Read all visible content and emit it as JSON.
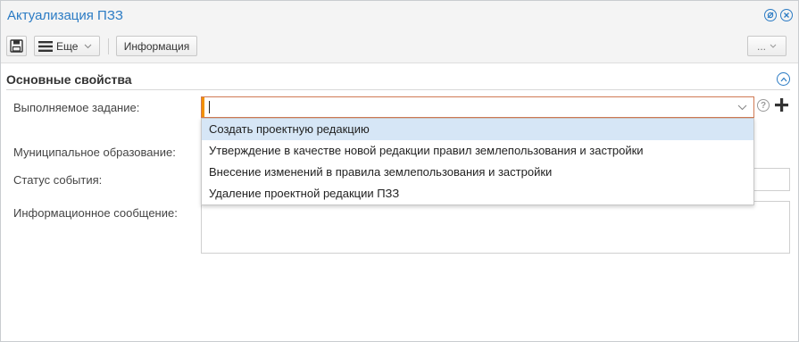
{
  "window": {
    "title": "Актуализация ПЗЗ"
  },
  "toolbar": {
    "more_label": "Еще",
    "info_label": "Информация",
    "ellipsis_label": "..."
  },
  "section": {
    "title": "Основные свойства"
  },
  "fields": {
    "task_label": "Выполняемое задание:",
    "task_value": "",
    "municipality_label": "Муниципальное образование:",
    "status_label": "Статус события:",
    "message_label": "Информационное сообщение:",
    "help_glyph": "?"
  },
  "dropdown": {
    "selected_index": 0,
    "options": [
      "Создать проектную редакцию",
      "Утверждение в качестве новой редакции правил землепользования и застройки",
      "Внесение изменений в правила землепользования и застройки",
      "Удаление проектной редакции ПЗЗ"
    ]
  },
  "colors": {
    "accent": "#2b7bc4",
    "required_marker": "#f29100",
    "selected_option_bg": "#d6e6f6"
  }
}
